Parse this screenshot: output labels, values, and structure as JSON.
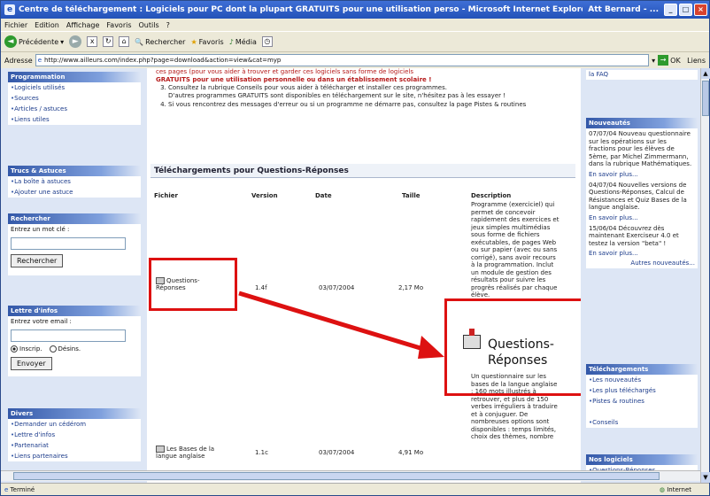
{
  "window": {
    "title": "Centre de téléchargement : Logiciels pour PC dont la plupart GRATUITS pour une utilisation perso - Microsoft Internet Explorer",
    "user": "Att Bernard - ..."
  },
  "menu": [
    "Fichier",
    "Edition",
    "Affichage",
    "Favoris",
    "Outils",
    "?"
  ],
  "toolbar": {
    "back": "Précédente",
    "search": "Rechercher",
    "favorites": "Favoris",
    "media": "Média"
  },
  "address": {
    "label": "Adresse",
    "url": "http://www.ailleurs.com/index.php?page=download&action=view&cat=myp",
    "go": "OK",
    "links": "Liens"
  },
  "sidebar": {
    "programmation": {
      "title": "Programmation",
      "items": [
        "Logiciels utilisés",
        "Sources",
        "Articles / astuces",
        "Liens utiles"
      ]
    },
    "trucs": {
      "title": "Trucs & Astuces",
      "items": [
        "La boîte à astuces",
        "Ajouter une astuce"
      ]
    },
    "recherche": {
      "title": "Rechercher",
      "label": "Entrez un mot clé :",
      "button": "Rechercher"
    },
    "lettre": {
      "title": "Lettre d'infos",
      "label": "Entrez votre email :",
      "opt1": "Inscrip.",
      "opt2": "Désins.",
      "button": "Envoyer"
    },
    "divers": {
      "title": "Divers",
      "items": [
        "Demander un cédérom",
        "Lettre d'infos",
        "Partenariat",
        "Liens partenaires"
      ]
    }
  },
  "main": {
    "line1": "ces pages (pour vous aider à trouver et garder ces logiciels sans forme de logiciels",
    "line2": "GRATUITS pour une utilisation personnelle ou dans un établissement scolaire !",
    "item3": "Consultez la rubrique Conseils pour vous aider à télécharger et installer ces programmes.",
    "item3b": "D'autres programmes GRATUITS sont disponibles en téléchargement sur le site, n'hésitez pas à les essayer !",
    "item4": "Si vous rencontrez des messages d'erreur ou si un programme ne démarre pas, consultez la page Pistes & routines",
    "dl_title": "Téléchargements pour Questions-Réponses",
    "headers": {
      "fichier": "Fichier",
      "version": "Version",
      "date": "Date",
      "taille": "Taille",
      "description": "Description"
    },
    "row1": {
      "file": "Questions-Réponses",
      "version": "1.4f",
      "date": "03/07/2004",
      "size": "2,17 Mo",
      "desc": "Programme (exerciciel) qui permet de concevoir rapidement des exercices et jeux simples multimédias sous forme de fichiers exécutables, de pages Web ou sur papier (avec ou sans corrigé), sans avoir recours à la programmation. Inclut un module de gestion des résultats pour suivre les progrès réalisés par chaque élève."
    },
    "row2": {
      "file": "Les Bases de la langue anglaise",
      "version": "1.1c",
      "date": "03/07/2004",
      "size": "4,91 Mo",
      "desc": "Un questionnaire sur les bases de la langue anglaise : 160 mots illustrés à retrouver, et plus de 150 verbes irréguliers à traduire et à conjuguer. De nombreuses options sont disponibles : temps limités, choix des thèmes, nombre"
    },
    "callout": "Questions-Réponses"
  },
  "right": {
    "top": "la FAQ",
    "nouveautes": {
      "title": "Nouveautés",
      "n1": "07/07/04 Nouveau questionnaire sur les opérations sur les fractions pour les élèves de 5ème, par Michel Zimmermann, dans la rubrique Mathématiques.",
      "n2": "04/07/04 Nouvelles versions de Questions-Réponses, Calcul de Résistances et Quiz Bases de la langue anglaise.",
      "n3": "15/06/04 Découvrez dès maintenant Exerciseur 4.0 et testez la version \"beta\" !",
      "more": "En savoir plus...",
      "all": "Autres nouveautés..."
    },
    "telech": {
      "title": "Téléchargements",
      "items": [
        "Les nouveautés",
        "Les plus téléchargés",
        "Pistes & routines",
        "Conseils"
      ]
    },
    "logiciels": {
      "title": "Nos logiciels",
      "items": [
        "Questions-Réponses"
      ]
    }
  },
  "status": {
    "left": "Terminé",
    "right": "Internet"
  }
}
